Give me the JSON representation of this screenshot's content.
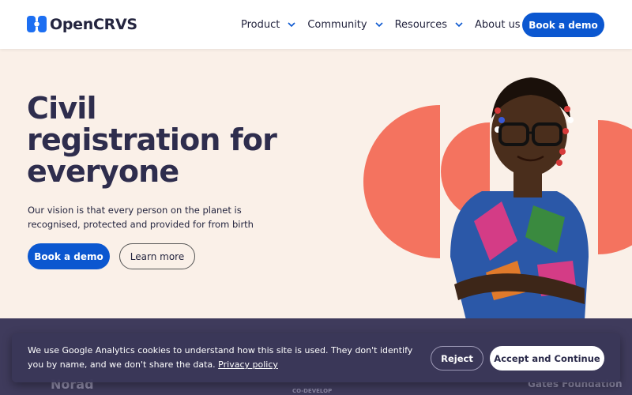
{
  "header": {
    "logo_text": "OpenCRVS",
    "nav": [
      {
        "label": "Product"
      },
      {
        "label": "Community"
      },
      {
        "label": "Resources"
      },
      {
        "label": "About us"
      }
    ],
    "cta_label": "Book a demo"
  },
  "hero": {
    "title": "Civil registration for everyone",
    "subtitle": "Our vision is that every person on the planet is recognised, protected and provided for from birth",
    "primary_button": "Book a demo",
    "secondary_button": "Learn more"
  },
  "partners": [
    "Norad",
    "CO-DEVELOP",
    "Gates Foundation"
  ],
  "cookie_banner": {
    "text": "We use Google Analytics cookies to understand how this site is used. They don't identify you by name, and we don't share the data.",
    "link_label": "Privacy policy",
    "reject_label": "Reject",
    "accept_label": "Accept and Continue"
  },
  "colors": {
    "accent_blue": "#0b57d0",
    "coral": "#f4735f",
    "hero_bg": "#faf0e8",
    "dark_navy": "#2e2d4d",
    "banner_bg": "#3a3758"
  }
}
